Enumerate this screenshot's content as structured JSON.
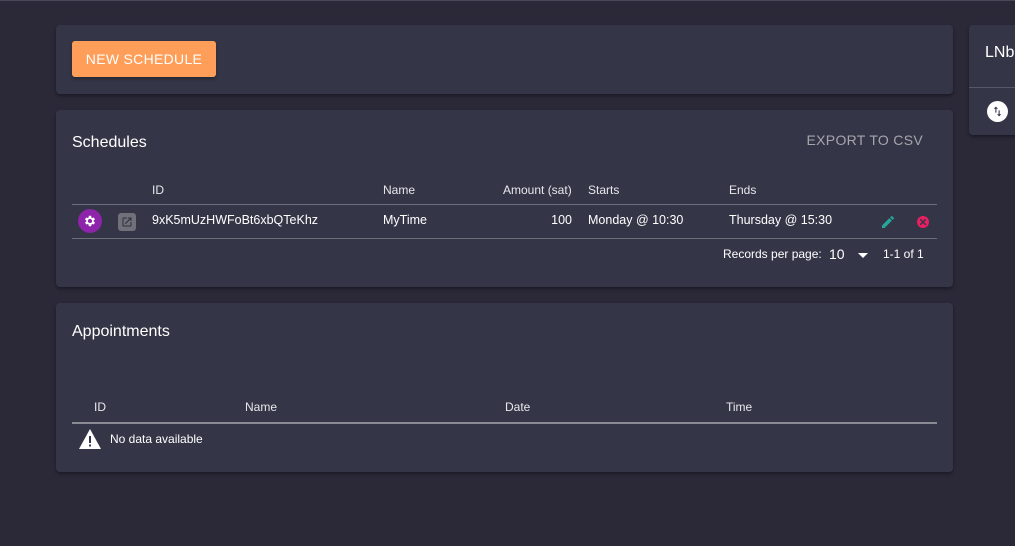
{
  "actions": {
    "new_schedule_label": "NEW SCHEDULE"
  },
  "schedules": {
    "title": "Schedules",
    "export_label": "EXPORT TO CSV",
    "columns": {
      "id": "ID",
      "name": "Name",
      "amount": "Amount (sat)",
      "starts": "Starts",
      "ends": "Ends"
    },
    "rows": [
      {
        "id": "9xK5mUzHWFoBt6xbQTeKhz",
        "name": "MyTime",
        "amount": "100",
        "starts": "Monday @ 10:30",
        "ends": "Thursday @ 15:30"
      }
    ],
    "pagination": {
      "records_label": "Records per page:",
      "per_page": "10",
      "range": "1-1 of 1"
    }
  },
  "appointments": {
    "title": "Appointments",
    "columns": {
      "id": "ID",
      "name": "Name",
      "date": "Date",
      "time": "Time"
    },
    "empty_text": "No data available"
  },
  "side": {
    "title": "LNb"
  },
  "icons": {
    "row_primary": "settings-icon",
    "row_link": "launch-icon",
    "row_edit": "edit-icon",
    "row_delete": "cancel-icon",
    "empty": "warning-icon",
    "side": "swap-vert-icon"
  },
  "colors": {
    "accent": "#ff9e58",
    "purple": "#8e24aa",
    "edit": "#26a69a",
    "delete": "#e91e63",
    "card": "#343647",
    "background": "#2b2838"
  }
}
